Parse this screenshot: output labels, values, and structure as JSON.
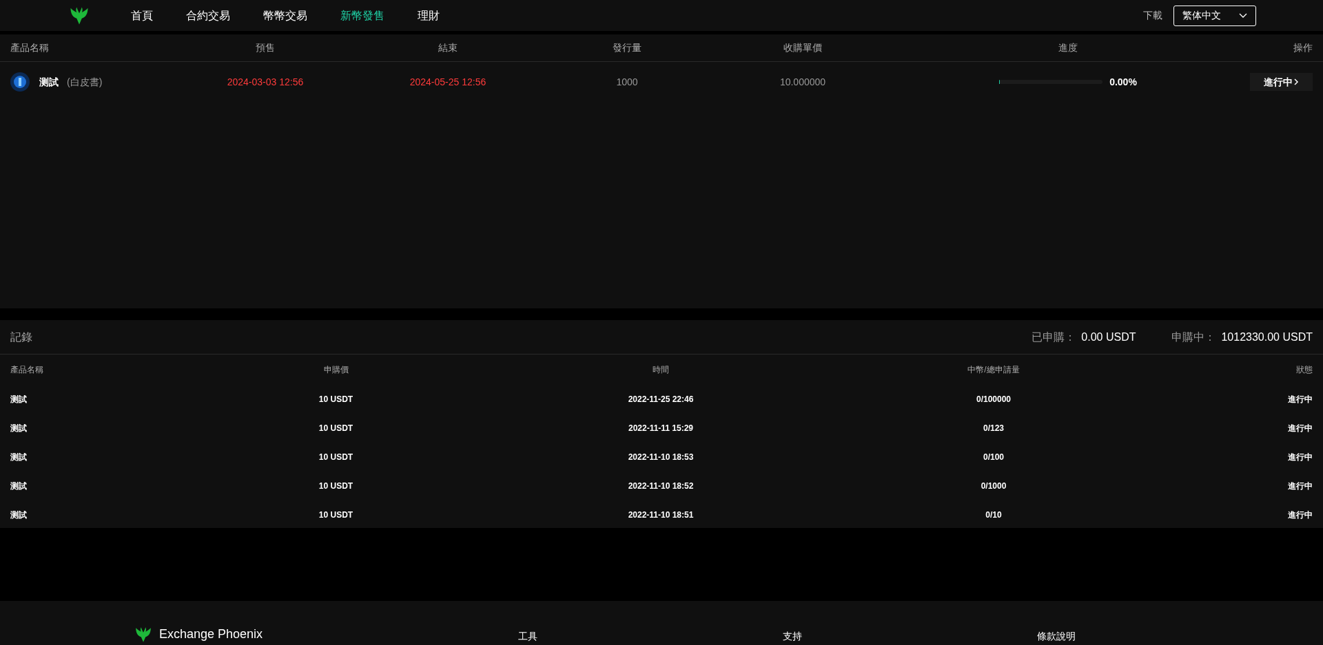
{
  "nav": {
    "items": [
      {
        "label": "首頁",
        "selected": false
      },
      {
        "label": "合約交易",
        "selected": false
      },
      {
        "label": "幣幣交易",
        "selected": false
      },
      {
        "label": "新幣發售",
        "selected": true
      },
      {
        "label": "理財",
        "selected": false
      }
    ],
    "download": "下載",
    "language": "繁体中文"
  },
  "products": {
    "columns": [
      "產品名稱",
      "預售",
      "結束",
      "發行量",
      "收購單價",
      "進度",
      "操作"
    ],
    "rows": [
      {
        "name": "测試",
        "whitepaper": "(白皮書)",
        "presale": "2024-03-03 12:56",
        "end": "2024-05-25 12:56",
        "supply": "1000",
        "price": "10.000000",
        "level": 0,
        "progress": "0.00%",
        "action": "進行中"
      }
    ]
  },
  "records": {
    "title": "記錄",
    "subscribed_label": "已申購：",
    "subscribed_value": "0.00 USDT",
    "pending_label": "申購中：",
    "pending_value": "1012330.00 USDT",
    "columns": [
      "產品名稱",
      "申購價",
      "時間",
      "中幣/總申請量",
      "狀態"
    ],
    "rows": [
      [
        "测試",
        "10 USDT",
        "2022-11-25 22:46",
        "0/100000",
        "進行中"
      ],
      [
        "测試",
        "10 USDT",
        "2022-11-11 15:29",
        "0/123",
        "進行中"
      ],
      [
        "测試",
        "10 USDT",
        "2022-11-10 18:53",
        "0/100",
        "進行中"
      ],
      [
        "测試",
        "10 USDT",
        "2022-11-10 18:52",
        "0/1000",
        "進行中"
      ],
      [
        "测試",
        "10 USDT",
        "2022-11-10 18:51",
        "0/10",
        "進行中"
      ]
    ]
  },
  "footer": {
    "brand": "Exchange Phoenix",
    "headings": [
      "工具",
      "支持",
      "條款說明"
    ]
  }
}
